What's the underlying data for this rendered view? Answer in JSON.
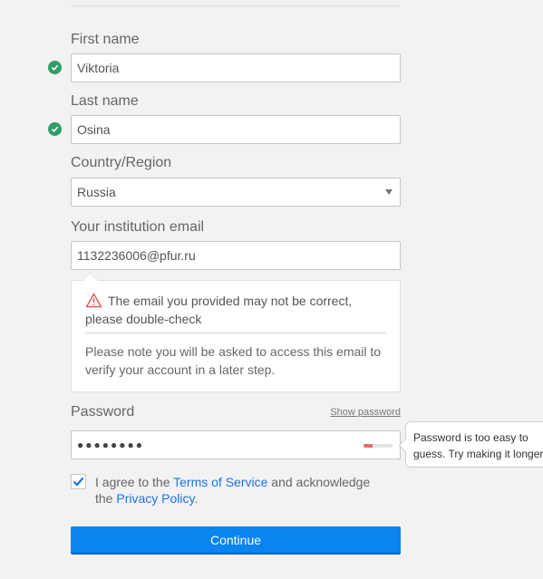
{
  "form": {
    "first_name": {
      "label": "First name",
      "value": "Viktoria",
      "valid": true
    },
    "last_name": {
      "label": "Last name",
      "value": "Osina",
      "valid": true
    },
    "country": {
      "label": "Country/Region",
      "value": "Russia"
    },
    "email": {
      "label": "Your institution email",
      "value": "1132236006@pfur.ru",
      "warning": "The email you provided may not be correct, please double-check",
      "note": "Please note you will be asked to access this email to verify your account in a later step."
    },
    "password": {
      "label": "Password",
      "show_label": "Show password",
      "masked_value": "●●●●●●●●",
      "strength_fraction": 0.3,
      "tooltip": "Password is too easy to guess. Try making it longer"
    },
    "agreement": {
      "checked": true,
      "prefix": "I agree to the ",
      "terms_link": "Terms of Service",
      "middle": " and acknowledge the ",
      "privacy_link": "Privacy Policy",
      "suffix": "."
    },
    "continue_label": "Continue"
  },
  "colors": {
    "accent": "#0a84ee",
    "valid_check": "#2e9e68",
    "warning": "#e05050",
    "strength_weak": "#e86a6a"
  }
}
